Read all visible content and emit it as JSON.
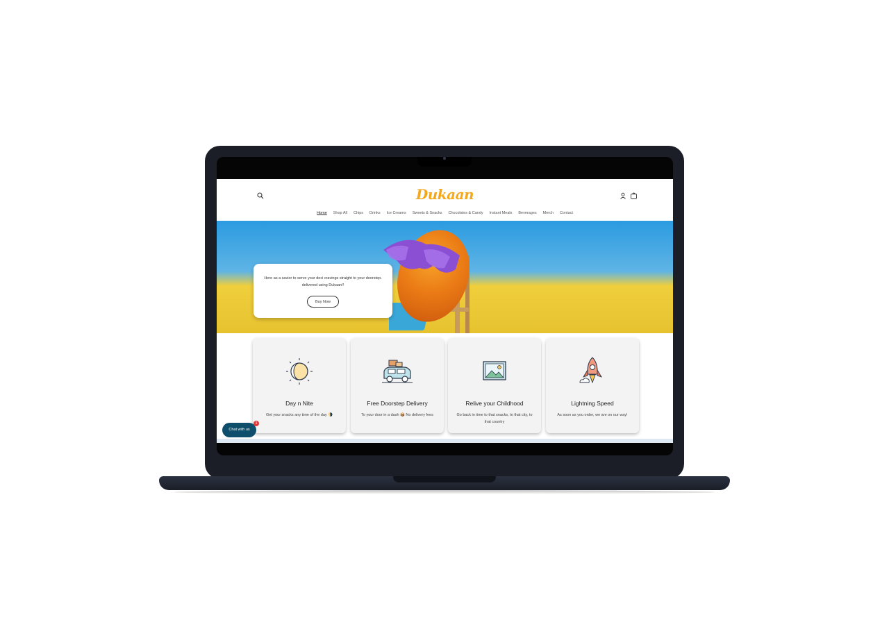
{
  "site": {
    "logo": "Dukaan"
  },
  "nav": {
    "items": [
      {
        "label": "Home",
        "active": true
      },
      {
        "label": "Shop All"
      },
      {
        "label": "Chips"
      },
      {
        "label": "Drinks"
      },
      {
        "label": "Ice Creams"
      },
      {
        "label": "Sweets & Snacks"
      },
      {
        "label": "Chocolates & Candy"
      },
      {
        "label": "Instant Meals"
      },
      {
        "label": "Beverages"
      },
      {
        "label": "Merch"
      },
      {
        "label": "Contact"
      }
    ]
  },
  "hero": {
    "text": "Here as a savior to serve your deci cravings straight to your doorstep. delivered using Dukaan!!",
    "button_label": "Buy Now"
  },
  "features": [
    {
      "title": "Day n Nite",
      "desc": "Get your snacks any time of the day 🌗",
      "icon": "moon-sun-icon"
    },
    {
      "title": "Free Doorstep Delivery",
      "desc": "To your door in a dash 📦 No delivery fees",
      "icon": "delivery-car-icon"
    },
    {
      "title": "Relive your Childhood",
      "desc": "Go back in time to that snacks, to that city, to that country",
      "icon": "picture-frame-icon"
    },
    {
      "title": "Lightning Speed",
      "desc": "As soon as you order, we are on our way!",
      "icon": "rocket-icon"
    }
  ],
  "chat": {
    "label": "Chat with us",
    "badge": "1"
  },
  "colors": {
    "logo": "#f4a71a",
    "chat_button": "#0f4f6b",
    "badge": "#e03a3a",
    "laptop": "#1b1e27"
  }
}
